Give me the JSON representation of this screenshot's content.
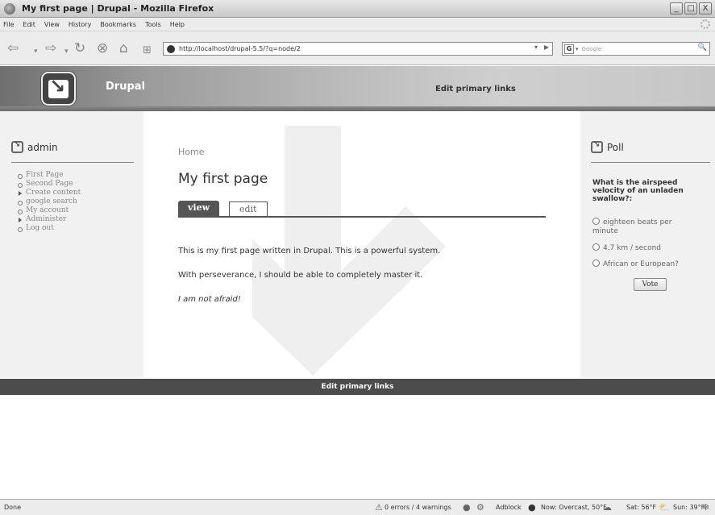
{
  "window": {
    "title": "My first page | Drupal - Mozilla Firefox",
    "buttons": {
      "minimize": "_",
      "maximize": "□",
      "close": "X"
    }
  },
  "menubar": [
    "File",
    "Edit",
    "View",
    "History",
    "Bookmarks",
    "Tools",
    "Help"
  ],
  "navigation": {
    "url": "http://localhost/drupal-5.5/?q=node/2",
    "search_placeholder": "Google",
    "search_engine": "G"
  },
  "header": {
    "site_name": "Drupal",
    "primary_links": "Edit primary links"
  },
  "sidebar_left": {
    "title": "admin",
    "items": [
      {
        "label": "First Page",
        "type": "leaf"
      },
      {
        "label": "Second Page",
        "type": "leaf"
      },
      {
        "label": "Create content",
        "type": "collapsed"
      },
      {
        "label": "google search",
        "type": "leaf"
      },
      {
        "label": "My account",
        "type": "leaf"
      },
      {
        "label": "Administer",
        "type": "collapsed"
      },
      {
        "label": "Log out",
        "type": "leaf"
      }
    ]
  },
  "main": {
    "breadcrumb": "Home",
    "title": "My first page",
    "tabs": [
      {
        "label": "view",
        "active": true
      },
      {
        "label": "edit",
        "active": false
      }
    ],
    "paragraphs": [
      "This is my first page written in Drupal. This is a powerful system.",
      "With perseverance, I should be able to completely master it.",
      "I am not afraid!"
    ]
  },
  "sidebar_right": {
    "title": "Poll",
    "question": "What is the airspeed velocity of an unladen swallow?:",
    "options": [
      {
        "line1": "eighteen beats per",
        "line2": "minute"
      },
      {
        "line1": "4.7 km / second",
        "line2": ""
      },
      {
        "line1": "African or European?",
        "line2": ""
      }
    ],
    "vote_label": "Vote"
  },
  "footer": {
    "primary_links": "Edit primary links"
  },
  "statusbar": {
    "status": "Done",
    "errors": "0 errors / 4 warnings",
    "adblock": "Adblock",
    "weather_now": "Now: Overcast, 50°F",
    "weather_sat": "Sat: 56°F",
    "weather_sun": "Sun: 39°F"
  },
  "colors": {
    "footer_bar": "#4c4c4c",
    "sidebar_bg": "#f1f1f1",
    "tab_active": "#555555"
  }
}
